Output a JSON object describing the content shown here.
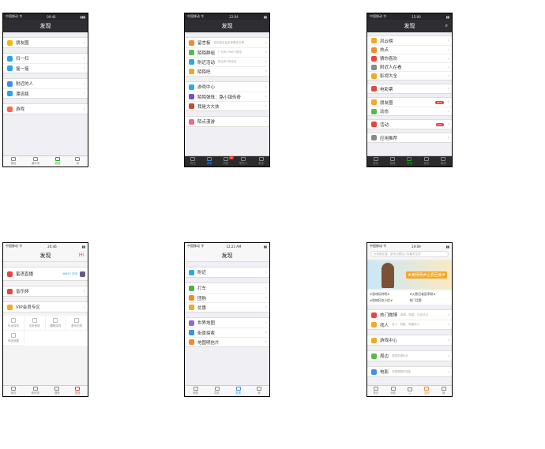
{
  "p1": {
    "carrier": "中国移动 令",
    "time": "09:46",
    "title": "发现",
    "items": [
      [
        "朋友圈",
        "#f7b500"
      ],
      [
        "扫一扫",
        "#2aa4ea"
      ],
      [
        "摇一摇",
        "#2aa4ea"
      ],
      [
        "附近的人",
        "#3d8fe6"
      ],
      [
        "漂流瓶",
        "#2aa4ea"
      ],
      [
        "游戏",
        "#f64"
      ]
    ],
    "tabs": [
      "微信",
      "通讯录",
      "发现",
      "我"
    ]
  },
  "p2": {
    "carrier": "中国移动 令",
    "time": "22:04",
    "title": "发现",
    "items": [
      [
        "留言板",
        "#f58a2a",
        "你的朋友留言等着你去看"
      ],
      [
        "陌陌群组",
        "#5bb94b",
        "广州有1968个群组"
      ],
      [
        "附近活动",
        "#29a9e8",
        "附近有3场活动"
      ],
      [
        "陌陌吧",
        "#f5a623",
        ""
      ],
      [
        "游戏中心",
        "#29a9e8",
        ""
      ],
      [
        "陌陌弹珠：路小镇传奇",
        "#6a55c8",
        ""
      ],
      [
        "我是大大侠",
        "#c9492b",
        ""
      ],
      [
        "陌点漫游",
        "#ea6a8c",
        ""
      ]
    ],
    "tabs": [
      "附近",
      "消息",
      "消息",
      "联系人",
      "更多"
    ],
    "badge": "1"
  },
  "p3": {
    "carrier": "中国移动 令",
    "time": "15:00",
    "title": "发现",
    "items": [
      [
        "风云榜",
        "#f5a623"
      ],
      [
        "热点",
        "#f58a2a"
      ],
      [
        "猜你喜欢",
        "#e8463c"
      ],
      [
        "附近人在看",
        "#8a8a8a"
      ],
      [
        "影视大全",
        "#f5a623"
      ],
      [
        "电影票",
        "#e8463c"
      ],
      [
        "朋友圈",
        "#f5a623"
      ],
      [
        "动态",
        "#5bb94b"
      ],
      [
        "活动",
        "#e8463c"
      ],
      [
        "应用推荐",
        "#8a8a8a"
      ]
    ],
    "badges": [
      "NEW",
      "HOT"
    ],
    "tabs": [
      "首页",
      "频道",
      "发现",
      "我的",
      "离线"
    ]
  },
  "p4": {
    "carrier": "中国移动 令",
    "time": "20:46",
    "title": "发现",
    "right": "Hi",
    "live": "蜜语直播",
    "live_sub": "46653 在线",
    "items": [
      [
        "音乐频",
        "#e8463c"
      ],
      [
        "VIP会员专区",
        "#f5a623"
      ]
    ],
    "grid": [
      "乐米耳机",
      "达听音效",
      "睡眠定时",
      "音乐识别",
      "系统设置"
    ],
    "tabs": [
      "我的",
      "音乐馆",
      "搜索",
      "发现"
    ]
  },
  "p5": {
    "carrier": "中国移动 令",
    "time": "12:23 AM",
    "title": "发现",
    "items": [
      [
        "附近",
        "#29a9e8"
      ],
      [
        "打车",
        "#4caf50"
      ],
      [
        "团购",
        "#f58a2a"
      ],
      [
        "优惠",
        "#f5a623"
      ],
      [
        "世界地图",
        "#8c6ccf"
      ],
      [
        "街景探索",
        "#3d8fe6"
      ],
      [
        "地图明信片",
        "#f58a2a"
      ]
    ],
    "tabs": [
      "地图",
      "导航",
      "发现",
      "我"
    ]
  },
  "p6": {
    "carrier": "中国移动 令",
    "time": "19:09",
    "search": "大家都在搜：游泳比赛加入你最关注的",
    "banner": "#美杨明#让爱回家#",
    "tags": [
      "#游戏玩转明#",
      "#火影忍者夏季联#",
      "#购物狂欢小优#",
      "热门话题"
    ],
    "items": [
      [
        "热门微博",
        "#e8463c",
        "新闻、明星、社会热点"
      ],
      [
        "找人",
        "#f5a623",
        "名人、明星、有趣的人"
      ],
      [
        "游戏中心",
        "#f5a623",
        ""
      ],
      [
        "周边",
        "#5bb94b",
        "周围吃喝玩乐"
      ],
      [
        "电影",
        "#3d8fe6",
        "你想要看的电影"
      ]
    ],
    "tabs": [
      "首页",
      "消息",
      "+",
      "发现",
      "我"
    ]
  }
}
